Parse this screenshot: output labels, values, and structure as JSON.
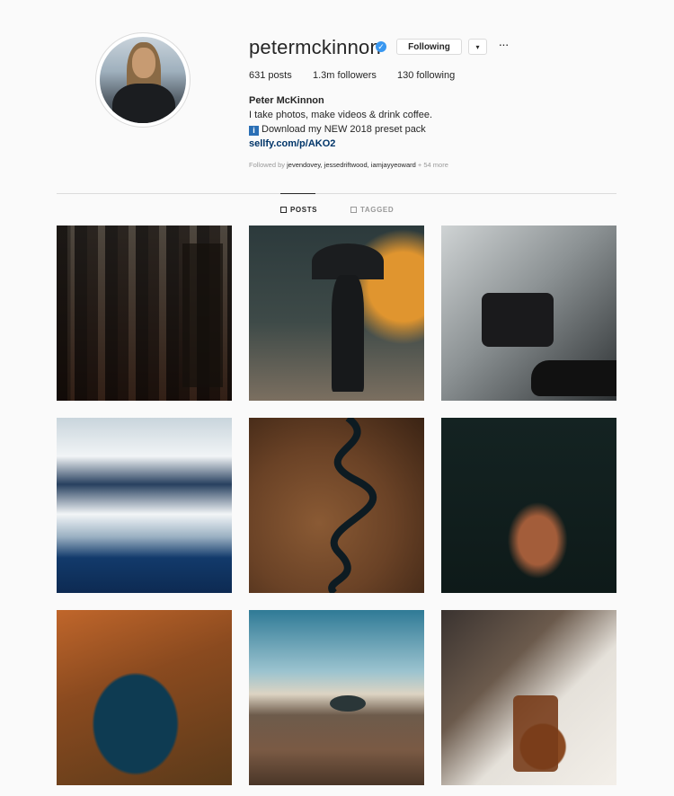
{
  "profile": {
    "username": "petermckinnon",
    "verified_icon": "verified-badge-icon",
    "following_label": "Following",
    "dropdown_glyph": "▾",
    "more_glyph": "···",
    "stats": {
      "posts": "631 posts",
      "followers": "1.3m followers",
      "following": "130 following"
    },
    "full_name": "Peter McKinnon",
    "bio_line": "I take photos, make videos & drink coffee.",
    "promo_icon": "i",
    "promo_text": "Download my NEW 2018 preset pack",
    "link": "sellfy.com/p/AKO2",
    "followed_by_prefix": "Followed by",
    "followed_by_names": "jevendovey, jessedriftwood, iamjayyeoward",
    "followed_by_more": "+ 54 more"
  },
  "tabs": {
    "posts": "POSTS",
    "tagged": "TAGGED"
  },
  "grid": {
    "posts": [
      {
        "subject": "fire escape buildings"
      },
      {
        "subject": "man with umbrella"
      },
      {
        "subject": "hand holding camera"
      },
      {
        "subject": "snowy mountain lake"
      },
      {
        "subject": "aerial river"
      },
      {
        "subject": "aerial rock in water"
      },
      {
        "subject": "autumn forest lake"
      },
      {
        "subject": "helicopter on rocks"
      },
      {
        "subject": "coffee mug"
      }
    ]
  },
  "colors": {
    "background": "#fafafa",
    "link": "#003569",
    "verified": "#3897f0",
    "muted": "#999999",
    "divider": "#dbdbdb"
  }
}
